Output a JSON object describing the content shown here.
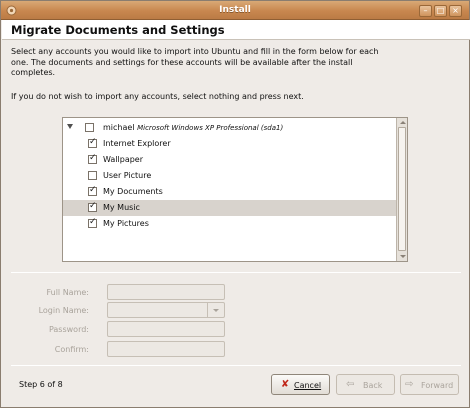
{
  "window": {
    "title": "Install",
    "icon": "ubuntu-installer-icon",
    "controls": [
      "minimize",
      "maximize",
      "close"
    ]
  },
  "header": {
    "heading": "Migrate Documents and Settings"
  },
  "intro": {
    "paragraph1": "Select any accounts you would like to import into Ubuntu and fill in the form below for each one.  The documents and settings for these accounts will be available after the install completes.",
    "paragraph2": "If you do not wish to import any accounts, select nothing and press next."
  },
  "accounts": {
    "user": "michael",
    "os": "Microsoft Windows XP Professional (sda1)",
    "user_checked": false,
    "expanded": true,
    "items": [
      {
        "label": "Internet Explorer",
        "checked": true
      },
      {
        "label": "Wallpaper",
        "checked": true
      },
      {
        "label": "User Picture",
        "checked": false
      },
      {
        "label": "My Documents",
        "checked": true
      },
      {
        "label": "My Music",
        "checked": true,
        "selected": true
      },
      {
        "label": "My Pictures",
        "checked": true
      }
    ]
  },
  "form": {
    "full_name_label": "Full Name:",
    "login_name_label": "Login Name:",
    "password_label": "Password:",
    "confirm_label": "Confirm:",
    "full_name_value": "",
    "login_name_value": "",
    "password_value": "",
    "confirm_value": "",
    "disabled": true
  },
  "footer": {
    "step": "Step 6 of 8",
    "cancel_label": "Cancel",
    "back_label": "Back",
    "forward_label": "Forward",
    "back_enabled": false,
    "forward_enabled": false
  },
  "colors": {
    "titlebar": "#c8874f",
    "window_bg": "#efebe7",
    "selected_row": "#d8d3cd"
  }
}
